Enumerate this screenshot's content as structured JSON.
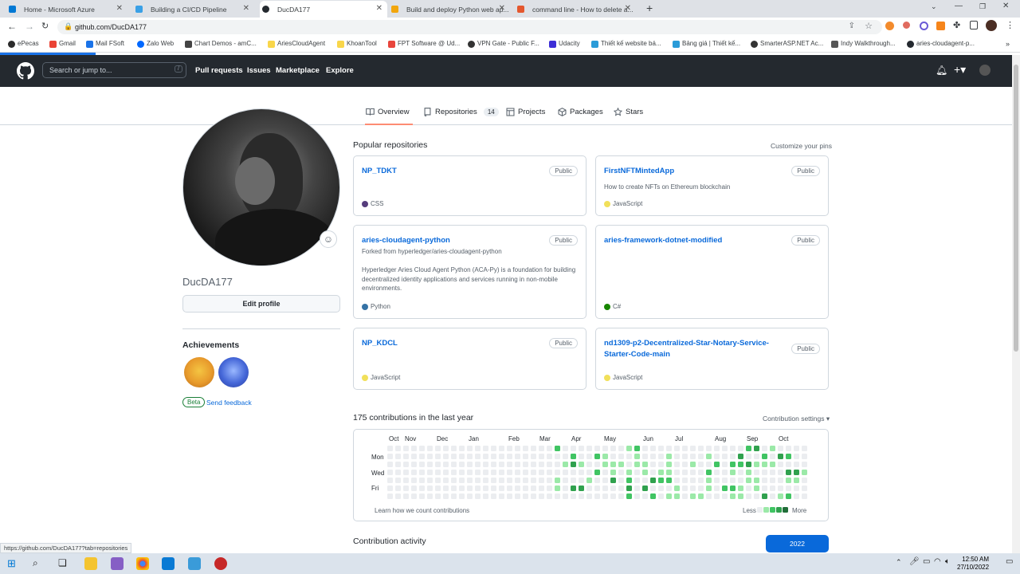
{
  "browser": {
    "tabs": [
      {
        "title": "Home - Microsoft Azure",
        "icon_color": "#0078d4"
      },
      {
        "title": "Building a CI/CD Pipeline",
        "icon_color": "#3aa0e6"
      },
      {
        "title": "DucDA177",
        "icon_color": "#24292f"
      },
      {
        "title": "Build and deploy Python web ap...",
        "icon_color": "#f2a60d"
      },
      {
        "title": "command line - How to delete a...",
        "icon_color": "#e4572e"
      }
    ],
    "url": "github.com/DucDA177",
    "bookmarks": [
      "ePecas",
      "Gmail",
      "Mail FSoft",
      "Zalo Web",
      "Chart Demos - amC...",
      "AriesCloudAgent",
      "KhoanTool",
      "FPT Software @ Ud...",
      "VPN Gate - Public F...",
      "Udacity",
      "Thiết kế website bá...",
      "Bảng giá | Thiết kế...",
      "SmarterASP.NET Ac...",
      "Indy Walkthrough...",
      "aries-cloudagent-p..."
    ]
  },
  "github_header": {
    "search_placeholder": "Search or jump to...",
    "slash": "/",
    "nav": [
      "Pull requests",
      "Issues",
      "Marketplace",
      "Explore"
    ]
  },
  "profile_tabs": [
    {
      "label": "Overview"
    },
    {
      "label": "Repositories",
      "count": "14"
    },
    {
      "label": "Projects"
    },
    {
      "label": "Packages"
    },
    {
      "label": "Stars"
    }
  ],
  "profile": {
    "username": "DucDA177",
    "edit_button": "Edit profile",
    "achievements_title": "Achievements",
    "beta_label": "Beta",
    "feedback_link": "Send feedback"
  },
  "pinned": {
    "title": "Popular repositories",
    "customize": "Customize your pins",
    "repos": [
      {
        "name": "NP_TDKT",
        "visibility": "Public",
        "forked": "",
        "description": "",
        "language": "CSS",
        "lang_color": "#563d7c"
      },
      {
        "name": "FirstNFTMintedApp",
        "visibility": "Public",
        "forked": "",
        "description": "How to create NFTs on Ethereum blockchain",
        "language": "JavaScript",
        "lang_color": "#f1e05a"
      },
      {
        "name": "aries-cloudagent-python",
        "visibility": "Public",
        "forked": "Forked from hyperledger/aries-cloudagent-python",
        "description": "Hyperledger Aries Cloud Agent Python (ACA-Py) is a foundation for building decentralized identity applications and services running in non-mobile environments.",
        "language": "Python",
        "lang_color": "#3572a5"
      },
      {
        "name": "aries-framework-dotnet-modified",
        "visibility": "Public",
        "forked": "",
        "description": "",
        "language": "C#",
        "lang_color": "#178600"
      },
      {
        "name": "NP_KDCL",
        "visibility": "Public",
        "forked": "",
        "description": "",
        "language": "JavaScript",
        "lang_color": "#f1e05a"
      },
      {
        "name": "nd1309-p2-Decentralized-Star-Notary-Service-Starter-Code-main",
        "visibility": "Public",
        "forked": "",
        "description": "",
        "language": "JavaScript",
        "lang_color": "#f1e05a"
      }
    ]
  },
  "contributions": {
    "title": "175 contributions in the last year",
    "settings": "Contribution settings ▾",
    "months": [
      "Oct",
      "Nov",
      "Dec",
      "Jan",
      "Feb",
      "Mar",
      "Apr",
      "May",
      "Jun",
      "Jul",
      "Aug",
      "Sep",
      "Oct"
    ],
    "days": [
      "Mon",
      "Wed",
      "Fri"
    ],
    "learn": "Learn how we count contributions",
    "less": "Less",
    "more": "More",
    "colors": [
      "#ebedf0",
      "#9be9a8",
      "#40c463",
      "#30a14e",
      "#216e39"
    ]
  },
  "activity": {
    "title": "Contribution activity",
    "year": "2022"
  },
  "status_url": "https://github.com/DucDA177?tab=repositories",
  "taskbar": {
    "time": "12:50 AM",
    "date": "27/10/2022"
  }
}
